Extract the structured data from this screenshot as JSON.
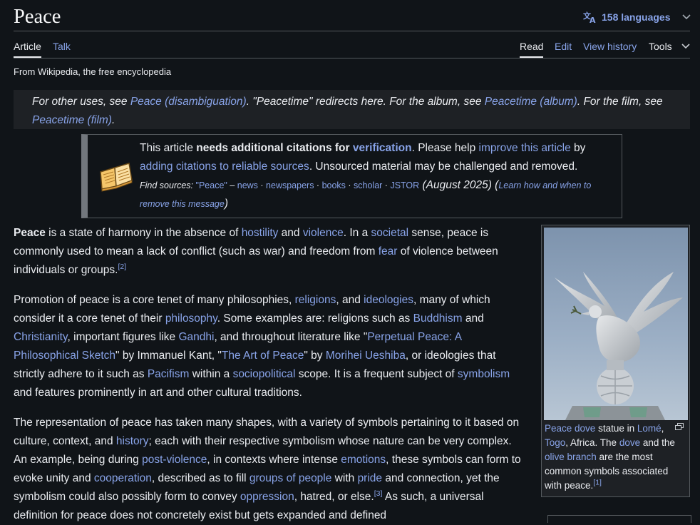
{
  "title": "Peace",
  "languages_label": "158 languages",
  "tabs": {
    "article": "Article",
    "talk": "Talk",
    "read": "Read",
    "edit": "Edit",
    "view_history": "View history",
    "tools": "Tools"
  },
  "tagline": "From Wikipedia, the free encyclopedia",
  "hatnote": {
    "t1": "For other uses, see ",
    "l1": "Peace (disambiguation)",
    "t2": ". \"Peacetime\" redirects here. For the album, see ",
    "l2": "Peacetime (album)",
    "t3": ". For the film, see ",
    "l3": "Peacetime (film)",
    "t4": "."
  },
  "ambox": {
    "t1": "This article ",
    "b1": "needs additional citations for ",
    "l1": "verification",
    "t2": ". Please help ",
    "l2": "improve this article",
    "t3": " by ",
    "l3": "adding citations to reliable sources",
    "t4": ". Unsourced material may be challenged and removed.",
    "find_label": "Find sources:",
    "f_peace": "\"Peace\"",
    "f_dash": " – ",
    "f_news": "news",
    "f_newspapers": "newspapers",
    "f_books": "books",
    "f_scholar": "scholar",
    "f_jstor": "JSTOR",
    "sep": " · ",
    "date": " (August 2025) (",
    "learn": "Learn how and when to remove this message",
    "close": ")"
  },
  "p1": {
    "bold": "Peace",
    "t1": " is a state of harmony in the absence of ",
    "l_hostility": "hostility",
    "t2": " and ",
    "l_violence": "violence",
    "t3": ". In a ",
    "l_societal": "societal",
    "t4": " sense, peace is commonly used to mean a lack of conflict (such as war) and freedom from ",
    "l_fear": "fear",
    "t5": " of violence between individuals or groups.",
    "ref": "[2]"
  },
  "p2": {
    "t1": "Promotion of peace is a core tenet of many philosophies, ",
    "l_religions": "religions",
    "t2": ", and ",
    "l_ideologies": "ideologies",
    "t3": ", many of which consider it a core tenet of their ",
    "l_philosophy": "philosophy",
    "t4": ". Some examples are: religions such as ",
    "l_buddhism": "Buddhism",
    "t5": " and ",
    "l_christianity": "Christianity",
    "t6": ", important figures like ",
    "l_gandhi": "Gandhi",
    "t7": ", and throughout literature like \"",
    "l_perpetual": "Perpetual Peace: A Philosophical Sketch",
    "t8": "\" by Immanuel Kant, \"",
    "l_artofpeace": "The Art of Peace",
    "t9": "\" by ",
    "l_ueshiba": "Morihei Ueshiba",
    "t10": ", or ideologies that strictly adhere to it such as ",
    "l_pacifism": "Pacifism",
    "t11": " within a ",
    "l_sociopolitical": "sociopolitical",
    "t12": " scope. It is a frequent subject of ",
    "l_symbolism": "symbolism",
    "t13": " and features prominently in art and other cultural traditions."
  },
  "p3": {
    "t1": "The representation of peace has taken many shapes, with a variety of symbols pertaining to it based on culture, context, and ",
    "l_history": "history",
    "t2": "; each with their respective symbolism whose nature can be very complex. An example, being during ",
    "l_postviolence": "post-violence",
    "t3": ", in contexts where intense ",
    "l_emotions": "emotions",
    "t4": ", these symbols can form to evoke unity and ",
    "l_cooperation": "cooperation",
    "t5": ", described as to fill ",
    "l_groups": "groups of people",
    "t6": " with ",
    "l_pride": "pride",
    "t7": " and connection, yet the symbolism could also possibly form to convey ",
    "l_oppression": "oppression",
    "t8": ", hatred, or else.",
    "ref": "[3]",
    "t9": " As such, a universal definition for peace does not concretely exist but gets expanded and defined"
  },
  "infobox": {
    "l_dove_statue": "Peace dove",
    "t1": " statue in ",
    "l_lome": "Lomé",
    "t2": ", ",
    "l_togo": "Togo",
    "t3": ", Africa. The ",
    "l_dove": "dove",
    "t4": " and the ",
    "l_olive": "olive branch",
    "t5": " are the most common symbols associated with peace.",
    "ref": "[1]"
  },
  "colors": {
    "background": "#101418",
    "link": "#88a3e8",
    "text": "#eaecf0",
    "hatnote_bg": "#1e2125"
  },
  "icons": [
    "translate-icon",
    "chevron-down-icon",
    "book-icon",
    "enlarge-icon"
  ]
}
